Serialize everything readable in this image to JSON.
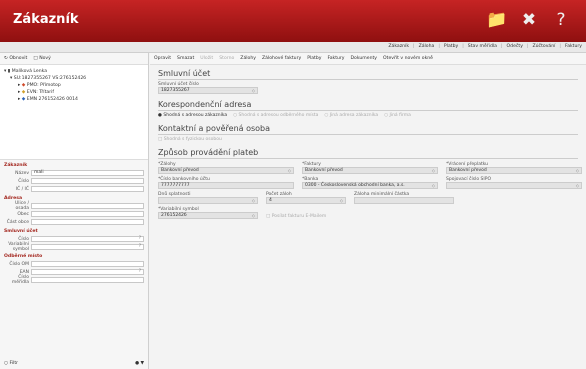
{
  "app": {
    "title": "Zákazník"
  },
  "header_icons": [
    "folder-icon",
    "tools-icon",
    "help-icon"
  ],
  "menu": {
    "items": [
      "Zákazník",
      "Záloha",
      "Platby",
      "Stav měřidla",
      "Odečty",
      "Zúčtování",
      "Faktury"
    ]
  },
  "left": {
    "toolbar": {
      "refresh": "Obnovit",
      "new": "Nový"
    },
    "tree": [
      {
        "level": 0,
        "label": "Malíková Lenka"
      },
      {
        "level": 1,
        "label": "SU:1827355267 VS:27615242б"
      },
      {
        "level": 2,
        "label": "PMO: Přímotop"
      },
      {
        "level": 2,
        "label": "EVN: Třítarif"
      },
      {
        "level": 2,
        "label": "EMN 27615242б 0014"
      }
    ],
    "customer": {
      "header": "Zákazník",
      "name_label": "Název",
      "name_value": "mali",
      "number_label": "Číslo",
      "ico_label": "IČ / IČ"
    },
    "address": {
      "header": "Adresa",
      "street_label": "Ulice / osada",
      "city_label": "Obec",
      "part_label": "Část obce"
    },
    "contract": {
      "header": "Smluvní účet",
      "number_label": "Číslo",
      "vs_label": "Variabilní symbol"
    },
    "delivery": {
      "header": "Odběrné místo",
      "om_label": "Číslo OM",
      "ean_label": "EAN",
      "meter_label": "Číslo měřidla"
    },
    "footer": {
      "filter": "Filtr"
    }
  },
  "right": {
    "toolbar": [
      "Opravit",
      "Smazat",
      "Uložit",
      "Storno",
      "Zálohy",
      "Zálohové faktury",
      "Platby",
      "Faktury",
      "Dokumenty",
      "Otevřít v novém okně"
    ],
    "contract": {
      "title": "Smluvní účet",
      "label": "Smluvní účet číslo",
      "value": "1827355267"
    },
    "corr": {
      "title": "Korespondenční adresa",
      "options": [
        "Shodná s adresou zákazníka",
        "Shodná s adresou odběrného místa",
        "Jiná adresa zákazníka",
        "Jiná firma"
      ]
    },
    "contact": {
      "title": "Kontaktní a pověřená osoba",
      "check": "Shodná s fyzickou osobou"
    },
    "payment": {
      "title": "Způsob provádění plateb",
      "zalohy_label": "*Zálohy",
      "zalohy_value": "Bankovní převod",
      "faktury_label": "*Faktury",
      "faktury_value": "Bankovní převod",
      "preplatky_label": "*Vrácení přeplatku",
      "preplatky_value": "Bankovní převod",
      "account_label": "*Číslo bankovního účtu",
      "account_value": "7777777777",
      "bank_label": "*Banka",
      "bank_value": "0300 - Československá obchodní banka, a.s.",
      "sipo_label": "Spojovací číslo SIPO",
      "due_label": "Dnů splatnosti",
      "count_label": "Počet záloh",
      "count_value": "4",
      "min_label": "Záloha minimální částka",
      "vs_label": "*Variabilní symbol",
      "vs_value": "27615242б",
      "posting_check": "Posílat fakturu E-Mailem"
    }
  }
}
